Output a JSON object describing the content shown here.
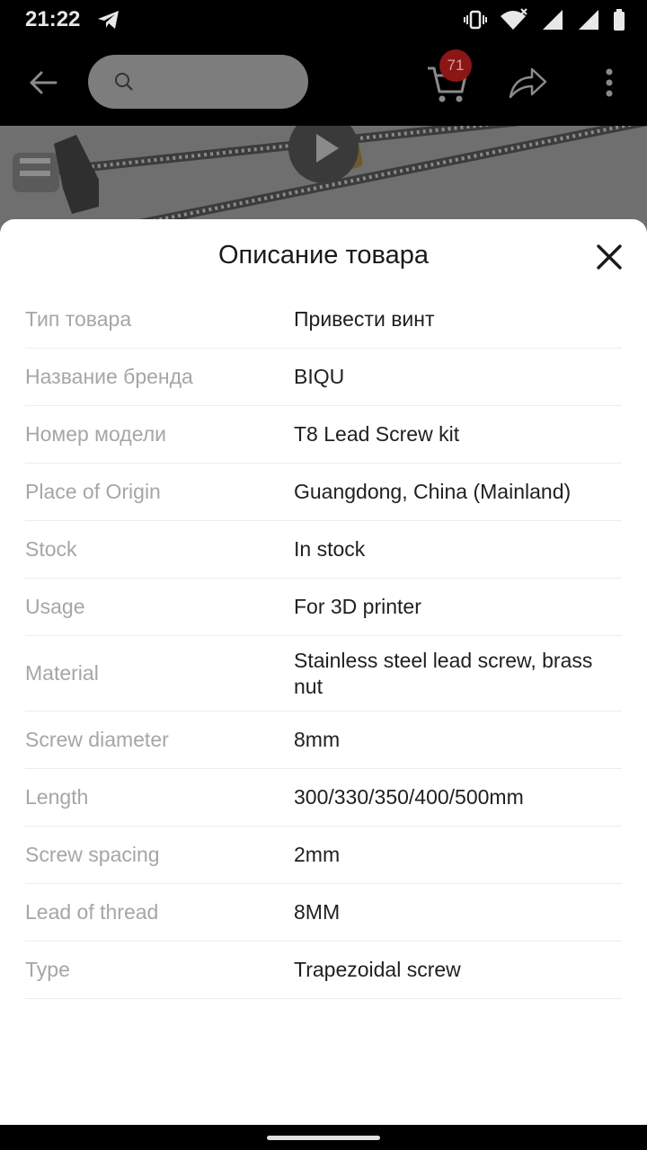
{
  "status": {
    "time": "21:22",
    "icons": [
      "telegram-icon",
      "vibrate-icon",
      "wifi-icon",
      "signal-icon",
      "signal-icon",
      "battery-icon"
    ]
  },
  "header": {
    "search_placeholder": "",
    "cart_badge": "71",
    "icons": [
      "back-arrow-icon",
      "search-icon",
      "cart-icon",
      "share-icon",
      "more-vert-icon"
    ]
  },
  "sheet": {
    "title": "Описание товара",
    "specs": [
      {
        "key": "Тип товара",
        "value": "Привести винт"
      },
      {
        "key": "Название бренда",
        "value": "BIQU"
      },
      {
        "key": "Номер модели",
        "value": "T8 Lead Screw kit"
      },
      {
        "key": "Place of Origin",
        "value": "Guangdong, China (Mainland)"
      },
      {
        "key": "Stock",
        "value": "In stock"
      },
      {
        "key": "Usage",
        "value": "For 3D printer"
      },
      {
        "key": "Material",
        "value": "Stainless steel lead screw, brass nut"
      },
      {
        "key": "Screw diameter",
        "value": "8mm"
      },
      {
        "key": "Length",
        "value": "300/330/350/400/500mm"
      },
      {
        "key": "Screw spacing",
        "value": "2mm"
      },
      {
        "key": "Lead of thread",
        "value": "8MM"
      },
      {
        "key": "Type",
        "value": "Trapezoidal screw"
      }
    ]
  },
  "colors": {
    "badge": "#8a1616",
    "key_text": "#a6a6a6",
    "value_text": "#1f1f1f"
  }
}
